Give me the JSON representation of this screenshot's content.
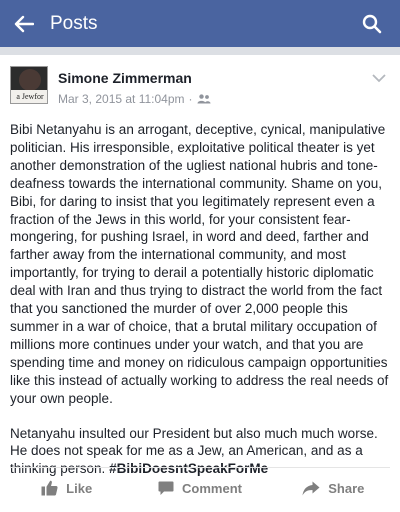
{
  "header": {
    "title": "Posts",
    "back_icon": "arrow-left-icon",
    "search_icon": "search-icon",
    "bar_color": "#4a64a0"
  },
  "post": {
    "author": "Simone Zimmerman",
    "avatar_caption": "a Jewfor",
    "timestamp": "Mar 3, 2015 at 11:04pm",
    "separator": "·",
    "audience_icon": "friends-icon",
    "paragraph_1": "Bibi Netanyahu is an arrogant, deceptive, cynical, manipulative politician. His irresponsible, exploitative political theater is yet another demonstration of the ugliest national hubris and tone-deafness towards the international community. Shame on you, Bibi, for daring to insist that you legitimately represent even a fraction of the Jews in this world, for your consistent fear-mongering, for pushing Israel, in word and deed, farther and farther away from the international community, and most importantly, for trying to derail a potentially historic diplomatic deal with Iran and thus trying to distract the world from the fact that you sanctioned the murder of over 2,000 people this summer in a war of choice, that a brutal military occupation of millions more continues under your watch, and that you are spending time and money on ridiculous campaign opportunities like this instead of actually working to address the real needs of your own people.",
    "paragraph_2": "Netanyahu insulted our President but also much much worse. He does not speak for me as a Jew, an American, and as a thinking person.",
    "hashtag": "#BibiDoesntSpeakForMe"
  },
  "actions": {
    "like": "Like",
    "comment": "Comment",
    "share": "Share"
  }
}
